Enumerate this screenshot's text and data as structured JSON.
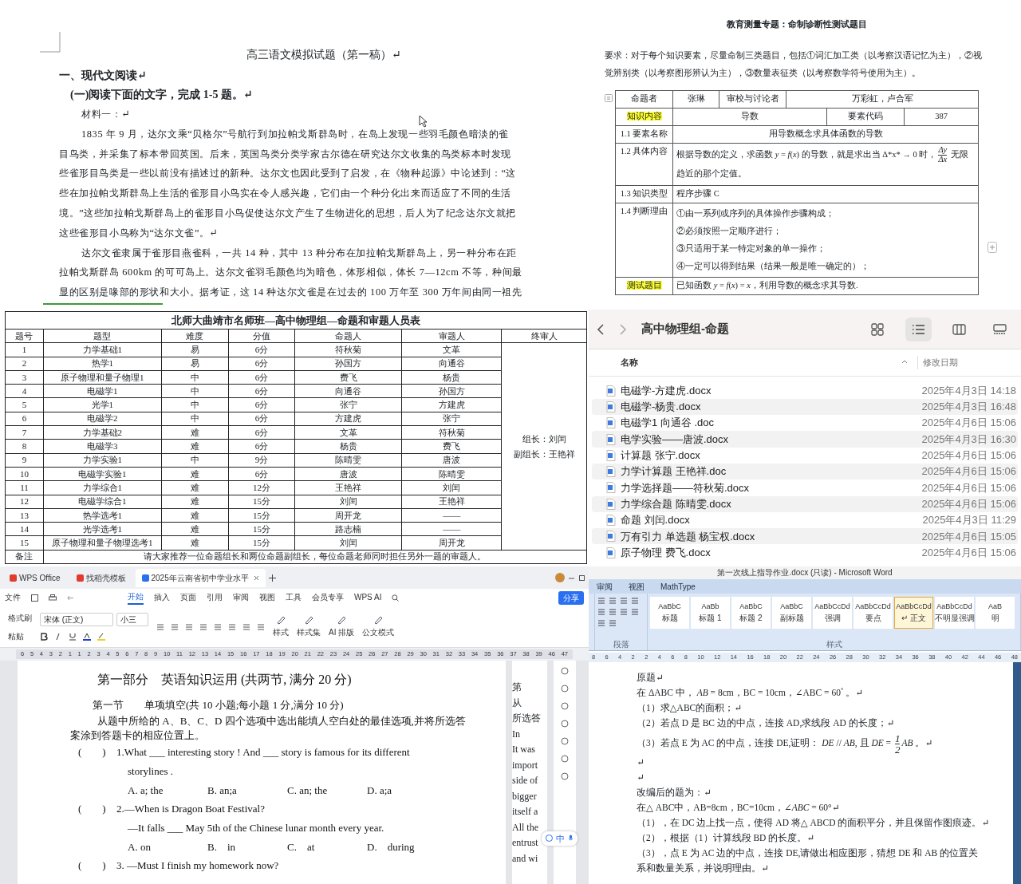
{
  "chinese_exam_doc": {
    "title": "高三语文模拟试题（第一稿）↵",
    "section": "一、现代文阅读↵",
    "instruction": "(一)阅读下面的文字，完成 1-5 题。↵",
    "material_label": "材料一：↵",
    "paragraphs": [
      [
        "1835 年 9 月，达尔文乘“贝格尔”号航行到加拉帕戈斯群岛时，在岛上发现一些羽毛颜色暗淡的雀",
        "目鸟类，并采集了标本带回英国。后来，英国鸟类分类学家古尔德在研究达尔文收集的鸟类标本时发现",
        "些雀形目鸟类是一些以前没有描述过的新种。达尔文也因此受到了启发，在《物种起源》中论述到：“这",
        "些在加拉帕戈斯群岛上生活的雀形目小鸟实在令人感兴趣，它们由一个种分化出来而适应了不同的生活",
        "境。”这些加拉帕戈斯群岛上的雀形目小鸟促使达尔文产生了生物进化的思想，后人为了纪念达尔文就把",
        "这些雀形目小鸟称为“达尔文雀”。↵"
      ],
      [
        "达尔文雀隶属于雀形目燕雀科，一共 14 种，其中 13 种分布在加拉帕戈斯群岛上，另一种分布在距",
        "拉帕戈斯群岛 600km 的可可岛上。达尔文雀羽毛颜色均为暗色，体形相似，体长 7—12cm 不等，种间最",
        "显的区别是喙部的形状和大小。据考证，这 14 种达尔文雀是在过去的 100 万年至 300 万年间由同一祖先"
      ]
    ]
  },
  "test_design_doc": {
    "title": "教育测量专题：命制诊断性测试题目",
    "requirement": "要求：对于每个知识要素，尽量命制三类题目，包括①词汇加工类（以考察汉语记忆为主），②视觉辨别类（以考察图形辨认为主），③数量表征类（以考察数学符号使用为主）。",
    "author": {
      "label": {
        "text": "命题者",
        "highlighted": false
      },
      "name": "张琳",
      "reviewer_label": "审校与讨论者",
      "reviewers": "万彩虹，卢合军"
    },
    "knowledge": {
      "label": {
        "text": "知识内容",
        "highlighted": true
      },
      "topic": "导数",
      "code_label": "要素代码",
      "code": "387"
    },
    "rows": [
      {
        "label": {
          "text": "1.1 要素名称",
          "highlighted": false
        },
        "cells": [
          "用导数概念求具体函数的导数"
        ]
      },
      {
        "label": {
          "text": "1.2 具体内容",
          "highlighted": false
        },
        "cells": [
          {
            "parts": [
              {
                "kind": "text",
                "text": "根据导数的定义，求函数 *y* = *f*(*x*) 的导数，就是求出当 Δ*x* → 0 时，"
              },
              {
                "kind": "fraction",
                "num": "Δy",
                "den": "Δx"
              },
              {
                "kind": "text",
                "text": " 无限趋近的那个定值。"
              }
            ]
          }
        ]
      },
      {
        "label": {
          "text": "1.3 知识类型",
          "highlighted": false
        },
        "cells": [
          "程序步骤 C"
        ]
      },
      {
        "label": {
          "text": "1.4 判断理由",
          "highlighted": false
        },
        "cells": [
          {
            "lines": [
              "①由一系列或序列的具体操作步骤构成；",
              "②必须按照一定顺序进行；",
              "③只适用于某一特定对象的单一操作；",
              "④一定可以得到结果（结果一般是唯一确定的）；"
            ]
          }
        ]
      },
      {
        "label": {
          "text": "测试题目",
          "highlighted": true
        },
        "cells": [
          "已知函数 *y* = *f*(*x*) = *x*，利用导数的概念求其导数."
        ]
      }
    ]
  },
  "staff_sheet": {
    "title": "北师大曲靖市名师班—高中物理组—命题和审题人员表",
    "columns": [
      "题号",
      "题型",
      "难度",
      "分值",
      "命题人",
      "审题人",
      "终审人"
    ],
    "rows": [
      [
        "1",
        "力学基础1",
        "易",
        "6分",
        "符秋菊",
        "文革"
      ],
      [
        "2",
        "热学1",
        "易",
        "6分",
        "孙国方",
        "向通谷"
      ],
      [
        "3",
        "原子物理和量子物理1",
        "中",
        "6分",
        "费飞",
        "杨贵"
      ],
      [
        "4",
        "电磁学1",
        "中",
        "6分",
        "向通谷",
        "孙国方"
      ],
      [
        "5",
        "光学1",
        "中",
        "6分",
        "张宁",
        "方建虎"
      ],
      [
        "6",
        "电磁学2",
        "中",
        "6分",
        "方建虎",
        "张宁"
      ],
      [
        "7",
        "力学基础2",
        "难",
        "6分",
        "文革",
        "符秋菊"
      ],
      [
        "8",
        "电磁学3",
        "难",
        "6分",
        "杨贵",
        "费飞"
      ],
      [
        "9",
        "力学实验1",
        "中",
        "9分",
        "陈晴雯",
        "唐波"
      ],
      [
        "10",
        "电磁学实验1",
        "难",
        "6分",
        "唐波",
        "陈晴雯"
      ],
      [
        "11",
        "力学综合1",
        "难",
        "12分",
        "王艳祥",
        "刘闰"
      ],
      [
        "12",
        "电磁学综合1",
        "难",
        "15分",
        "刘闰",
        "王艳祥"
      ],
      [
        "13",
        "热学选考1",
        "难",
        "15分",
        "周开龙",
        "——"
      ],
      [
        "14",
        "光学选考1",
        "难",
        "15分",
        "路志楠",
        "——"
      ],
      [
        "15",
        "原子物理和量子物理选考1",
        "难",
        "15分",
        "刘闰",
        "周开龙"
      ]
    ],
    "final_reviewers": [
      "组长：刘闰",
      "副组长：王艳祥"
    ],
    "note_label": "备注",
    "note": "请大家推荐一位命题组长和两位命题副组长，每位命题老师同时担任另外一题的审题人。"
  },
  "finder": {
    "title": "高中物理组-命题",
    "view_modes": [
      {
        "kind": "icons",
        "selected": false
      },
      {
        "kind": "list",
        "selected": true
      },
      {
        "kind": "columns",
        "selected": false
      },
      {
        "kind": "gallery",
        "selected": false
      }
    ],
    "columns": [
      "名称",
      "修改日期"
    ],
    "files": [
      {
        "name": "电磁学-方建虎.docx",
        "date": "2025年4月3日 14:18"
      },
      {
        "name": "电磁学-杨贵.docx",
        "date": "2025年4月3日 16:48"
      },
      {
        "name": "电磁学1 向通谷 .doc",
        "date": "2025年4月6日 15:06"
      },
      {
        "name": "电学实验——唐波.docx",
        "date": "2025年4月3日 16:30"
      },
      {
        "name": "计算题 张宁.docx",
        "date": "2025年4月6日 15:06"
      },
      {
        "name": "力学计算题  王艳祥.doc",
        "date": "2025年4月6日 15:06"
      },
      {
        "name": "力学选择题——符秋菊.docx",
        "date": "2025年4月6日 15:06"
      },
      {
        "name": "力学综合题 陈晴雯.docx",
        "date": "2025年4月6日 15:06"
      },
      {
        "name": "命题 刘闰.docx",
        "date": "2025年4月3日 11:29"
      },
      {
        "name": "万有引力 单选题 杨宝权.docx",
        "date": "2025年4月6日 15:05"
      },
      {
        "name": "原子物理  费飞.docx",
        "date": "2025年4月6日 15:06"
      }
    ]
  },
  "wps_window": {
    "tabs": [
      {
        "label": "WPS Office",
        "selected": false
      },
      {
        "label": "找稻壳模板",
        "selected": false
      },
      {
        "label": "2025年云南省初中学业水平",
        "selected": true
      }
    ],
    "file_menu": "文件",
    "ribbon_tabs": [
      {
        "label": "开始",
        "selected": true
      },
      {
        "label": "插入",
        "selected": false
      },
      {
        "label": "页面",
        "selected": false
      },
      {
        "label": "引用",
        "selected": false
      },
      {
        "label": "审阅",
        "selected": false
      },
      {
        "label": "视图",
        "selected": false
      },
      {
        "label": "工具",
        "selected": false
      },
      {
        "label": "会员专享",
        "selected": false
      },
      {
        "label": "WPS AI",
        "selected": false
      }
    ],
    "share": "分享",
    "ruler_text": "6 5 4 3 2 1 1 2 3 4 5 6 7 8 9 10 11 12 13 14 15 16 17 18 19 20 21 22 23 24 25 26 27 28 29 30 31 32 33 34 35 36 37 38 39 46 47",
    "format_painter": "格式刷",
    "paste": "粘贴",
    "font": "宋体 (正文)",
    "size": "小三",
    "styles": "样式",
    "style_set": "样式集",
    "ai_layout": "AI 排版",
    "official_mode": "公文模式",
    "heading": "第一部分　英语知识运用 (共两节, 满分 20 分)",
    "subheading": "第一节　　单项填空(共 10 小题;每小题 1 分,满分 10 分)",
    "directions": "从题中所给的 A、B、C、D 四个选项中选出能填人空白处的最佳选项,并将所选答案涂到答题卡的相应位置上。",
    "questions": [
      {
        "bracket": "(　　)",
        "stem": [
          "1.What ___ interesting story ! And ___ story is famous for its different",
          "storylines ."
        ],
        "options": [
          "A. a; the",
          "B. an;a",
          "C. an; the",
          "D. a;a"
        ]
      },
      {
        "bracket": "(　　)",
        "stem": [
          "2.—When is Dragon Boat Festival?",
          "—It falls ___ May 5th of the Chinese lunar month every year."
        ],
        "options": [
          "A. on",
          "B.　in",
          "C.　at",
          "D.　during"
        ]
      },
      {
        "bracket": "(　　)",
        "stem": [
          "3. —Must I finish my homework now?"
        ]
      }
    ],
    "next_page_lines": [
      "第",
      "从",
      "所选答",
      "In",
      "It was",
      "import",
      "side of",
      "bigger",
      "itself a",
      "All the",
      "entrust",
      "and wi"
    ],
    "ime_label": "中"
  },
  "word_window": {
    "title": "第一次线上指导作业.docx (只读) - Microsoft Word",
    "tabs": [
      "审阅",
      "视图",
      "MathType"
    ],
    "styles": [
      {
        "sample": "AaBbC",
        "name": "标题",
        "selected": false
      },
      {
        "sample": "AaBb",
        "name": "标题 1",
        "selected": false
      },
      {
        "sample": "AaBbC",
        "name": "标题 2",
        "selected": false
      },
      {
        "sample": "AaBbC",
        "name": "副标题",
        "selected": false
      },
      {
        "sample": "AaBbCcDd",
        "name": "强调",
        "selected": false
      },
      {
        "sample": "AaBbCcDd",
        "name": "要点",
        "selected": false
      },
      {
        "sample": "AaBbCcDd",
        "name": "↵ 正文",
        "selected": true
      },
      {
        "sample": "AaBbCcDd",
        "name": "不明显强调",
        "selected": false
      },
      {
        "sample": "AaB",
        "name": "明",
        "selected": false
      }
    ],
    "groups": [
      "段落",
      "样式"
    ],
    "ruler_text": "8 6 4 2 2 4 6 8 10 12 14 16 18 20 22 24 26 28 30 32 34 36 38 40 42 44 46 48",
    "lines": [
      {
        "text": "原题↵"
      },
      {
        "text": "在 ΔABC 中， *AB* = 8cm，BC = 10cm，∠ABC = 60$^{°}$ 。↵"
      },
      {
        "text": "（1）求△ABC的面积；↵"
      },
      {
        "text": "（2）若点 D 是 BC 边的中点，连接 AD,求线段 AD 的长度；↵"
      },
      {
        "parts": [
          {
            "kind": "text",
            "text": "（3）若点 E 为 AC 的中点，连接 DE,证明： *DE* // *AB*, 且 *DE* = "
          },
          {
            "kind": "fraction",
            "num": "1",
            "den": "2"
          },
          {
            "kind": "text",
            "text": "*AB* 。↵"
          }
        ]
      },
      {
        "text": "↵"
      },
      {
        "text": "↵"
      },
      {
        "text": "改编后的题为：↵"
      },
      {
        "text": "在△ ABC中，AB=8cm，BC=10cm，∠*ABC* = 60°↵"
      },
      {
        "text": "（1），在 DC 边上找一点，使得 AD 将△ ABCD 的面积平分，并且保留作图痕迹。↵"
      },
      {
        "text": "（2），根据（1）计算线段 BD 的长度。↵"
      },
      {
        "text": "（3），点 E 为 AC 边的中点，连接 DE,请做出相应图形，猜想 DE 和 AB 的位置关系和数量关系，并说明理由。↵"
      }
    ]
  }
}
